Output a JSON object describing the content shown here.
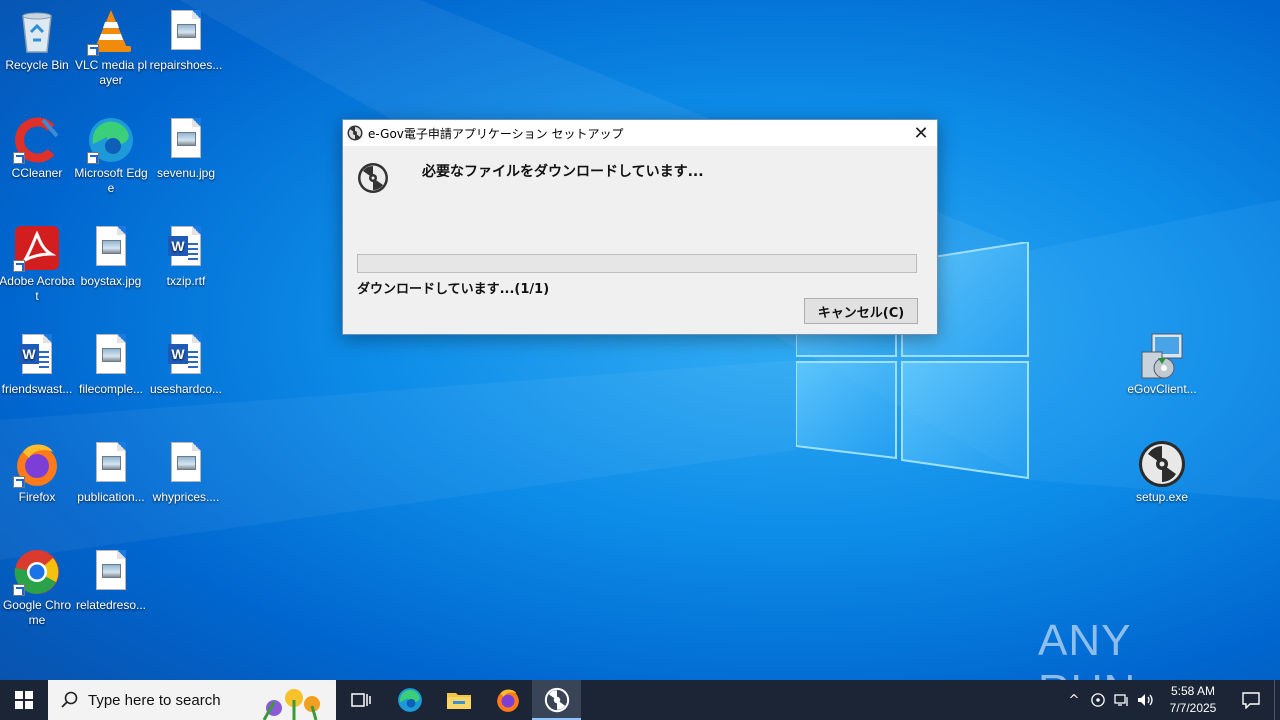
{
  "desktop": {
    "icons": [
      {
        "label": "Recycle Bin",
        "icon": "recycle-bin-icon"
      },
      {
        "label": "VLC media player",
        "icon": "vlc-icon"
      },
      {
        "label": "repairshoes...",
        "icon": "image-file-icon"
      },
      {
        "label": "CCleaner",
        "icon": "ccleaner-icon"
      },
      {
        "label": "Microsoft Edge",
        "icon": "edge-icon"
      },
      {
        "label": "sevenu.jpg",
        "icon": "image-file-icon"
      },
      {
        "label": "Adobe Acrobat",
        "icon": "acrobat-icon"
      },
      {
        "label": "boystax.jpg",
        "icon": "image-file-icon"
      },
      {
        "label": "txzip.rtf",
        "icon": "word-file-icon"
      },
      {
        "label": "friendswast...",
        "icon": "word-file-icon"
      },
      {
        "label": "filecomple...",
        "icon": "image-file-icon"
      },
      {
        "label": "useshardco...",
        "icon": "word-file-icon"
      },
      {
        "label": "Firefox",
        "icon": "firefox-icon"
      },
      {
        "label": "publication...",
        "icon": "image-file-icon"
      },
      {
        "label": "whyprices....",
        "icon": "image-file-icon"
      },
      {
        "label": "Google Chrome",
        "icon": "chrome-icon"
      },
      {
        "label": "relatedreso...",
        "icon": "image-file-icon"
      },
      {
        "label": "eGovClient...",
        "icon": "installer-icon"
      },
      {
        "label": "setup.exe",
        "icon": "disc-icon"
      }
    ]
  },
  "dialog": {
    "title": "e-Gov電子申請アプリケーション セットアップ",
    "heading": "必要なファイルをダウンロードしています...",
    "status": "ダウンロードしています...(1/1)",
    "progress": 0,
    "cancel_label": "キャンセル(C)",
    "close_glyph": "✕"
  },
  "watermark": {
    "text": "ANY RUN"
  },
  "taskbar": {
    "search_placeholder": "Type here to search",
    "time": "5:58 AM",
    "date": "7/7/2025",
    "tray_up_glyph": "^"
  },
  "colors": {
    "desktop_blue": "#0d8ce8",
    "taskbar": "#1b2535",
    "progress_fill": "#06b025"
  }
}
